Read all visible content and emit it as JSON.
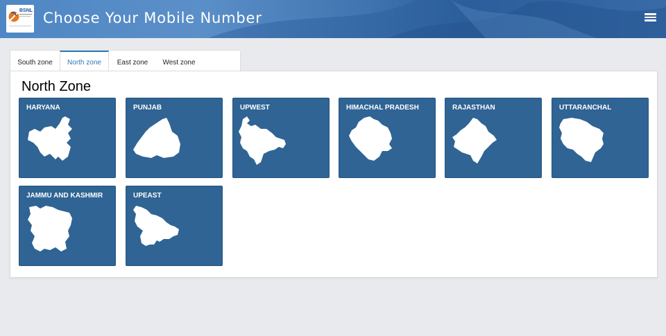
{
  "header": {
    "logo_text": "BSNL",
    "title": "Choose Your Mobile Number",
    "menu_icon": "hamburger-menu-icon"
  },
  "tabs": [
    {
      "label": "South zone",
      "active": false
    },
    {
      "label": "North zone",
      "active": true
    },
    {
      "label": "East zone",
      "active": false
    },
    {
      "label": "West zone",
      "active": false
    }
  ],
  "panel": {
    "title": "North Zone",
    "states": [
      {
        "label": "HARYANA"
      },
      {
        "label": "PUNJAB"
      },
      {
        "label": "UPWEST"
      },
      {
        "label": "HIMACHAL PRADESH"
      },
      {
        "label": "RAJASTHAN"
      },
      {
        "label": "UTTARANCHAL"
      },
      {
        "label": "JAMMU AND KASHMIR"
      },
      {
        "label": "UPEAST"
      }
    ]
  },
  "colors": {
    "card_bg": "#2f6494",
    "active_tab": "#2a78b7",
    "header_bg": "#3f74b0"
  }
}
